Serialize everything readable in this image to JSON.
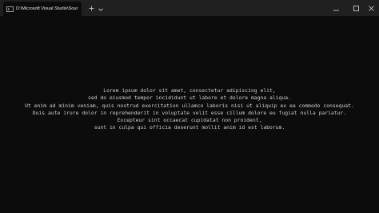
{
  "window": {
    "tab_title": "D:\\Microsoft Visual Studio\\Sour",
    "icons": {
      "tab": "terminal-icon",
      "new_tab": "plus-icon",
      "tab_menu": "chevron-down-icon",
      "minimize": "minimize-icon",
      "maximize": "maximize-icon",
      "close": "close-icon"
    }
  },
  "terminal": {
    "lines": [
      "Lorem ipsum dolor sit amet, consectetur adipiscing elit,",
      "sed do eiusmod tempor incididunt ut labore et dolore magna aliqua.",
      "Ut enim ad minim veniam, quis nostrud exercitation ullamco laboris nisi ut aliquip ex ea commodo consequat.",
      "Duis aute irure dolor in reprehenderit in voluptate velit esse cillum dolore eu fugiat nulla pariatur.",
      "Excepteur sint occaecat cupidatat non proident,",
      "sunt in culpa qui officia deserunt mollit anim id est laborum."
    ]
  },
  "colors": {
    "background": "#0c0c0c",
    "titlebar": "#202020",
    "text": "#cccccc"
  }
}
